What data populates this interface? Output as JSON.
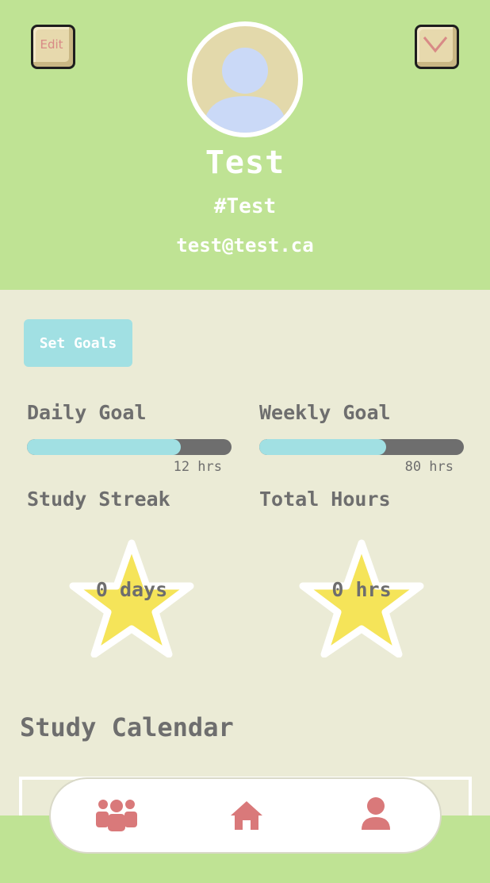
{
  "header": {
    "edit_label": "Edit",
    "username": "Test",
    "tag": "#Test",
    "email": "test@test.ca"
  },
  "goals": {
    "set_goals_label": "Set Goals",
    "daily": {
      "label": "Daily Goal",
      "hours": "12 hrs",
      "progress": 0.75
    },
    "weekly": {
      "label": "Weekly Goal",
      "hours": "80 hrs",
      "progress": 0.62
    }
  },
  "stats": {
    "streak_label": "Study Streak",
    "streak_value": "0 days",
    "total_label": "Total Hours",
    "total_value": "0 hrs"
  },
  "calendar": {
    "title": "Study Calendar"
  },
  "nav": {
    "items": [
      {
        "icon": "group-icon"
      },
      {
        "icon": "home-icon"
      },
      {
        "icon": "profile-icon"
      }
    ]
  },
  "colors": {
    "header_bg": "#bfe394",
    "body_bg": "#ebebd6",
    "accent": "#a1e0e3",
    "star": "#f5e459",
    "text_gray": "#6e6e6e",
    "icon_pink": "#d9797a"
  }
}
